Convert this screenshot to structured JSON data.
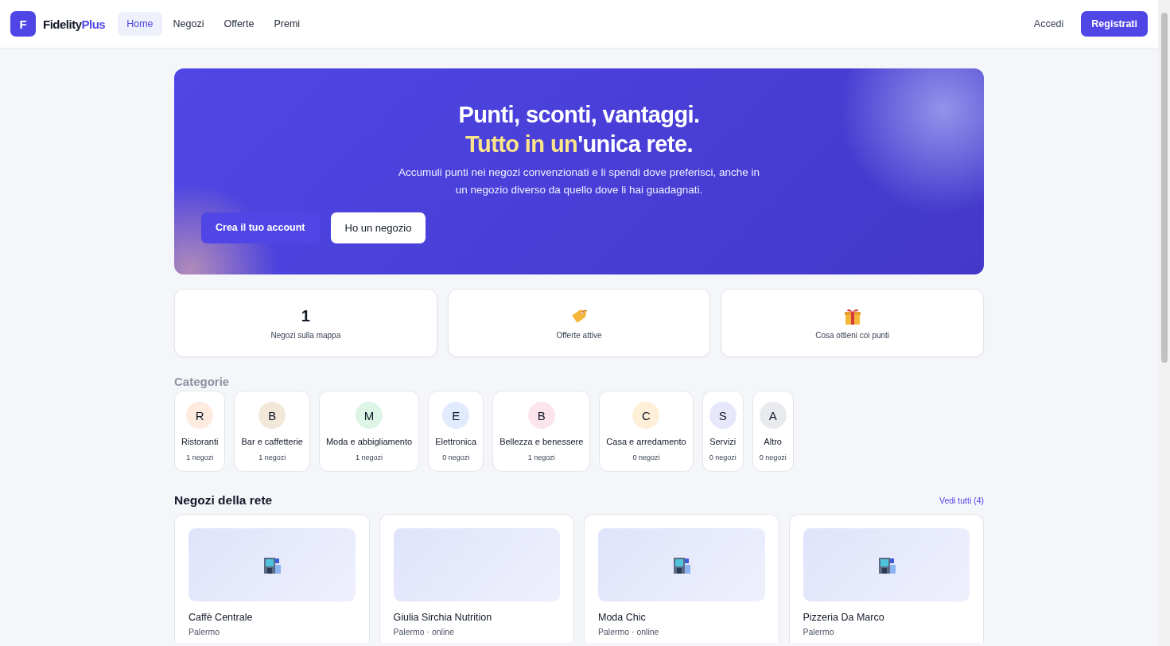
{
  "brand": {
    "logo_letter": "F",
    "name": "Fidelity",
    "name_accent": "Plus"
  },
  "nav": [
    {
      "label": "Home",
      "selected": true
    },
    {
      "label": "Negozi",
      "selected": false
    },
    {
      "label": "Offerte",
      "selected": false
    },
    {
      "label": "Premi",
      "selected": false
    }
  ],
  "account": {
    "login": "Accedi",
    "register": "Registrati"
  },
  "hero": {
    "headline": "Punti, sconti, vantaggi.",
    "headline_highlight": "Tutto in un",
    "headline_rest": "'unica rete.",
    "text": "Accumuli punti nei negozi convenzionati e li spendi dove preferisci, anche in un negozio diverso da quello dove li hai guadagnati.",
    "primary_button": "Crea il tuo account",
    "secondary_button": "Ho un negozio"
  },
  "stats": [
    {
      "kind": "number",
      "value": "1",
      "label": "Negozi sulla mappa"
    },
    {
      "kind": "tag",
      "label": "Offerte attive"
    },
    {
      "kind": "gift",
      "label": "Cosa ottieni coi punti"
    }
  ],
  "categories_title": "Categorie",
  "categories": [
    {
      "letter": "R",
      "name": "Ristoranti",
      "count": "1 negozi",
      "color": "#fdebe0"
    },
    {
      "letter": "B",
      "name": "Bar e caffetterie",
      "count": "1 negozi",
      "color": "#f3e7da"
    },
    {
      "letter": "M",
      "name": "Moda e abbigliamento",
      "count": "1 negozi",
      "color": "#dcf5e6"
    },
    {
      "letter": "E",
      "name": "Elettronica",
      "count": "0 negozi",
      "color": "#e0ebfd"
    },
    {
      "letter": "B",
      "name": "Bellezza e benessere",
      "count": "1 negozi",
      "color": "#fce4ec"
    },
    {
      "letter": "C",
      "name": "Casa e arredamento",
      "count": "0 negozi",
      "color": "#feefd8"
    },
    {
      "letter": "S",
      "name": "Servizi",
      "count": "0 negozi",
      "color": "#e6e7fb"
    },
    {
      "letter": "A",
      "name": "Altro",
      "count": "0 negozi",
      "color": "#e8eaee"
    }
  ],
  "stores_section": {
    "title": "Negozi della rete",
    "see_all": "Vedi tutti (4)"
  },
  "stores": [
    {
      "name": "Caffè Centrale",
      "location": "Palermo",
      "has_icon": true
    },
    {
      "name": "Giulia Sirchia Nutrition",
      "location": "Palermo · online",
      "has_icon": false
    },
    {
      "name": "Moda Chic",
      "location": "Palermo · online",
      "has_icon": true
    },
    {
      "name": "Pizzeria Da Marco",
      "location": "Palermo",
      "has_icon": true
    }
  ]
}
